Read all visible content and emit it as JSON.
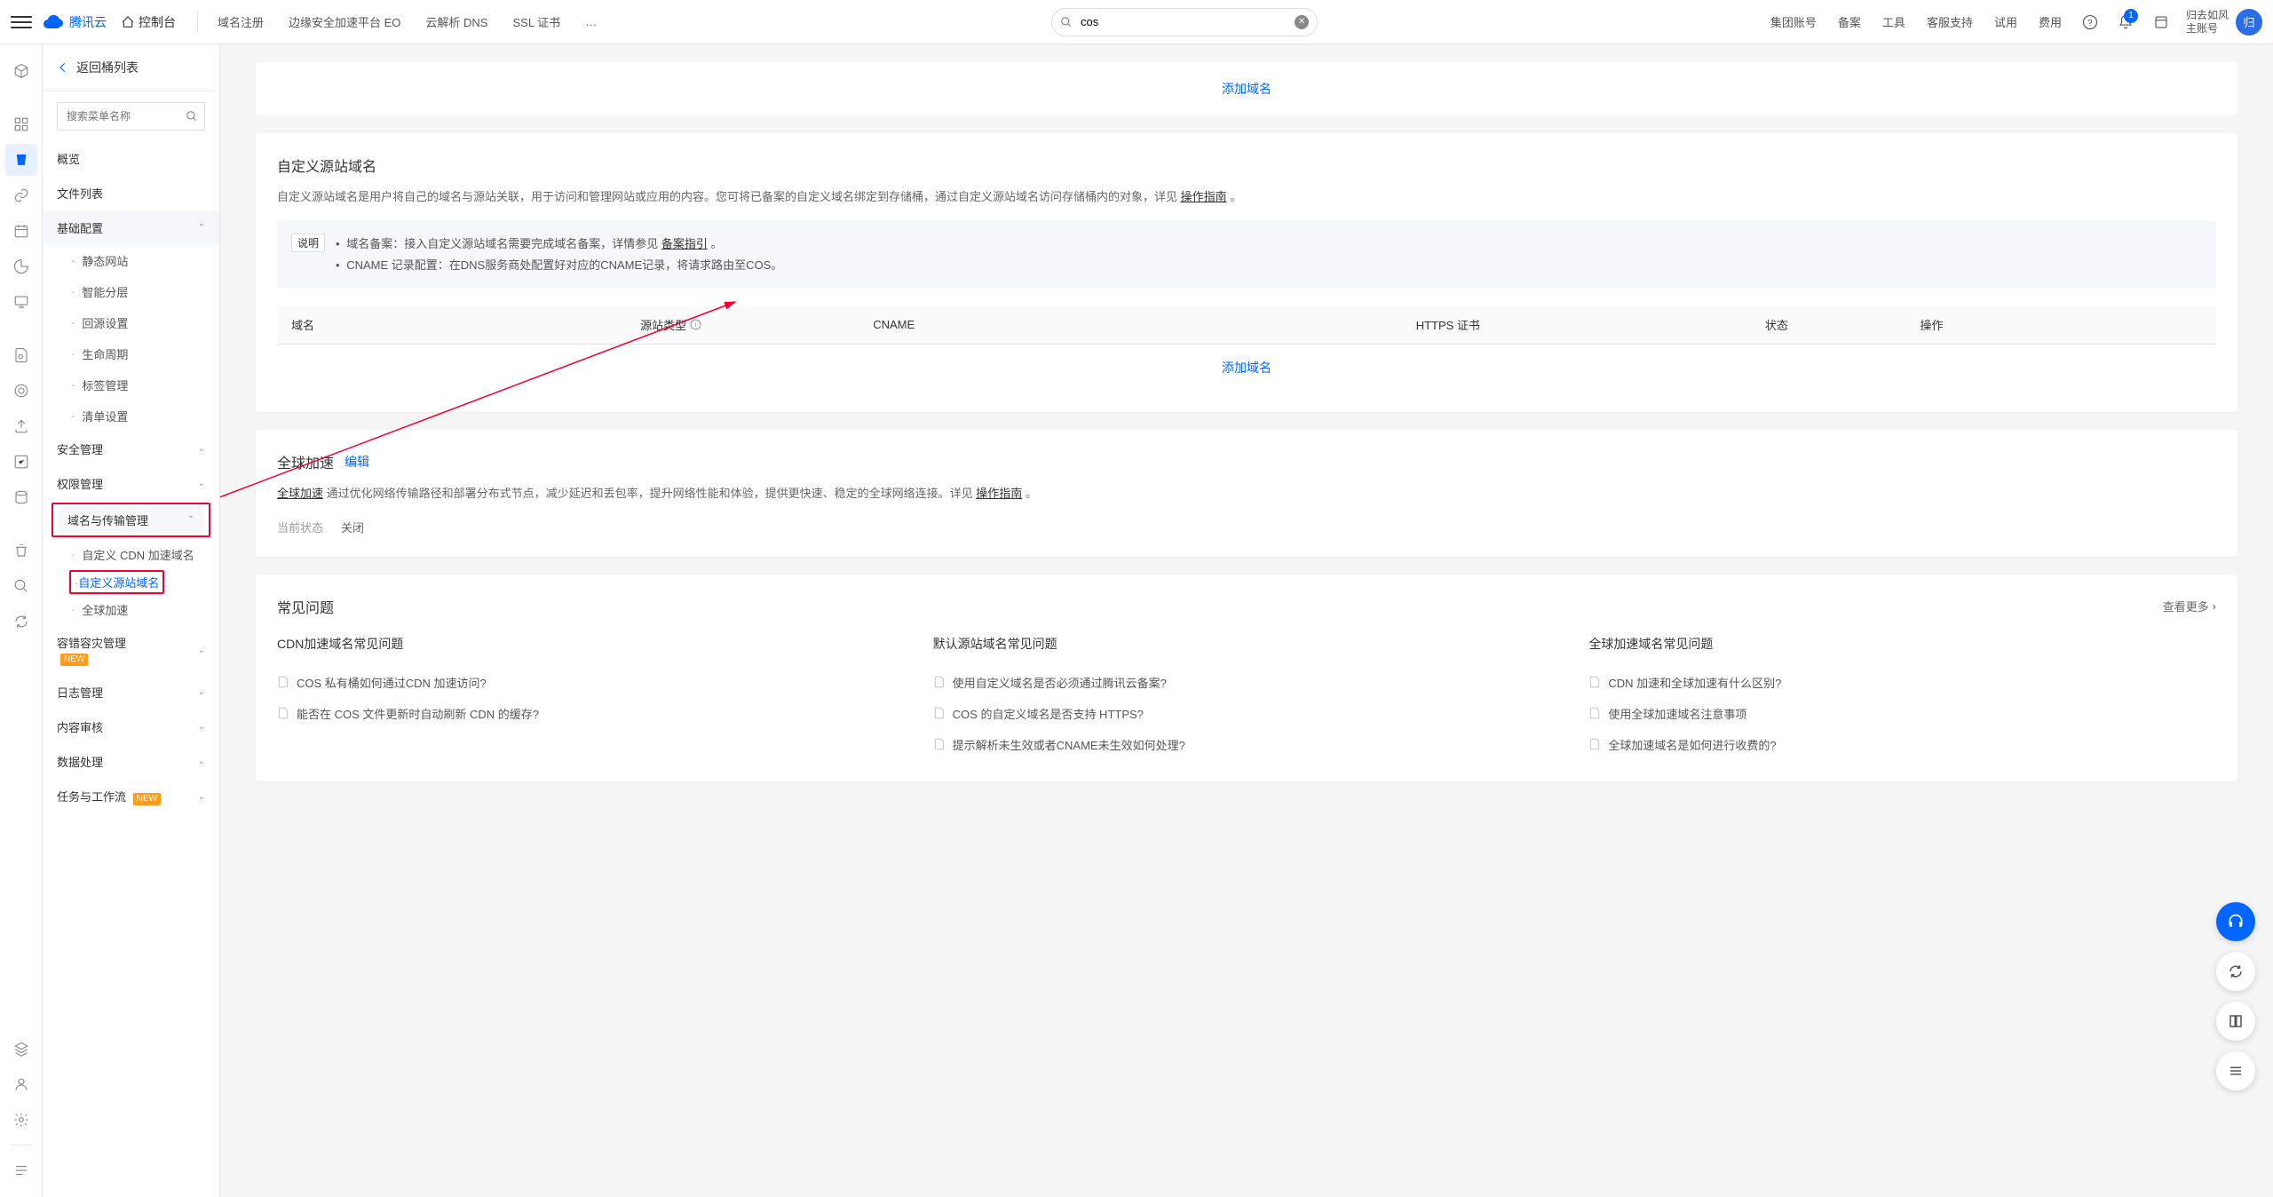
{
  "header": {
    "logo_text": "腾讯云",
    "console": "控制台",
    "nav": [
      "域名注册",
      "边缘安全加速平台 EO",
      "云解析 DNS",
      "SSL 证书",
      "…"
    ],
    "search_placeholder": "",
    "search_value": "cos",
    "right_nav": [
      "集团账号",
      "备案",
      "工具",
      "客服支持",
      "试用",
      "费用"
    ],
    "user_line1": "归去如风",
    "user_line2": "主账号",
    "avatar_char": "归",
    "notif_count": "1"
  },
  "sidebar": {
    "back_label": "返回桶列表",
    "search_placeholder": "搜索菜单名称",
    "items": {
      "overview": "概览",
      "file_list": "文件列表",
      "basic_config": "基础配置",
      "static_site": "静态网站",
      "smart_tier": "智能分层",
      "origin_pull": "回源设置",
      "lifecycle": "生命周期",
      "tag_mgmt": "标签管理",
      "inventory": "清单设置",
      "security_mgmt": "安全管理",
      "permission_mgmt": "权限管理",
      "domain_transfer": "域名与传输管理",
      "custom_cdn": "自定义 CDN 加速域名",
      "custom_origin": "自定义源站域名",
      "global_accel": "全球加速",
      "fault_tolerance": "容错容灾管理",
      "log_mgmt": "日志管理",
      "content_audit": "内容审核",
      "data_process": "数据处理",
      "task_workflow": "任务与工作流",
      "new_badge": "NEW"
    }
  },
  "main": {
    "top_link": "添加域名",
    "section1": {
      "title": "自定义源站域名",
      "desc_pre": "自定义源站域名是用户将自己的域名与源站关联，用于访问和管理网站或应用的内容。您可将已备案的自定义域名绑定到存储桶，通过自定义源站域名访问存储桶内的对象，详见 ",
      "desc_link": "操作指南",
      "desc_suffix": " 。",
      "info_label": "说明",
      "info_items": [
        {
          "pre": "域名备案：接入自定义源站域名需要完成域名备案，详情参见 ",
          "link": "备案指引",
          "suffix": " 。"
        },
        {
          "pre": "CNAME 记录配置：在DNS服务商处配置好对应的CNAME记录，将请求路由至COS。",
          "link": "",
          "suffix": ""
        }
      ],
      "columns": [
        "域名",
        "源站类型",
        "CNAME",
        "HTTPS 证书",
        "状态",
        "操作"
      ],
      "add_domain": "添加域名"
    },
    "section2": {
      "title": "全球加速",
      "edit_link": "编辑",
      "desc_link1": "全球加速",
      "desc_mid": " 通过优化网络传输路径和部署分布式节点，减少延迟和丢包率，提升网络性能和体验，提供更快速、稳定的全球网络连接。详见 ",
      "desc_link2": "操作指南",
      "desc_suffix": " 。",
      "status_label": "当前状态",
      "status_value": "关闭"
    },
    "faq": {
      "title": "常见问题",
      "more": "查看更多",
      "cols": [
        {
          "title": "CDN加速域名常见问题",
          "items": [
            "COS 私有桶如何通过CDN 加速访问?",
            "能否在 COS 文件更新时自动刷新 CDN 的缓存?"
          ]
        },
        {
          "title": "默认源站域名常见问题",
          "items": [
            "使用自定义域名是否必须通过腾讯云备案?",
            "COS 的自定义域名是否支持 HTTPS?",
            "提示解析未生效或者CNAME未生效如何处理?"
          ]
        },
        {
          "title": "全球加速域名常见问题",
          "items": [
            "CDN 加速和全球加速有什么区别?",
            "使用全球加速域名注意事项",
            "全球加速域名是如何进行收费的?"
          ]
        }
      ]
    }
  }
}
